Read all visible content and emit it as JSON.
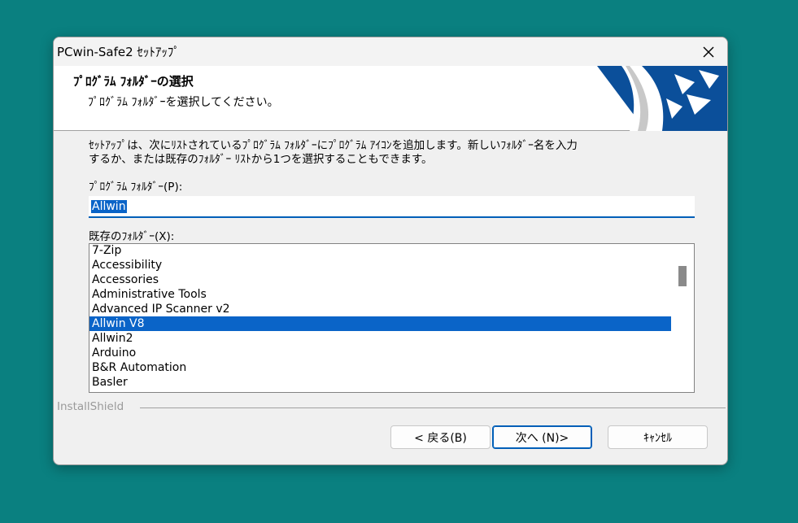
{
  "window": {
    "title": "PCwin-Safe2 ｾｯﾄｱｯﾌﾟ",
    "close_label": "✕"
  },
  "header": {
    "title": "ﾌﾟﾛｸﾞﾗﾑ ﾌｫﾙﾀﾞｰの選択",
    "subtitle": "ﾌﾟﾛｸﾞﾗﾑ ﾌｫﾙﾀﾞｰを選択してください。"
  },
  "description": {
    "line1": "ｾｯﾄｱｯﾌﾟは、次にﾘｽﾄされているﾌﾟﾛｸﾞﾗﾑ ﾌｫﾙﾀﾞｰにﾌﾟﾛｸﾞﾗﾑ ｱｲｺﾝを追加します。新しいﾌｫﾙﾀﾞｰ名を入力",
    "line2": "するか、または既存のﾌｫﾙﾀﾞｰ ﾘｽﾄから1つを選択することもできます。"
  },
  "program_folder": {
    "label": "ﾌﾟﾛｸﾞﾗﾑ ﾌｫﾙﾀﾞｰ(P):",
    "value": "Allwin"
  },
  "existing_folders": {
    "label": "既存のﾌｫﾙﾀﾞｰ(X):",
    "items": [
      "7-Zip",
      "Accessibility",
      "Accessories",
      "Administrative Tools",
      "Advanced IP Scanner v2",
      "Allwin V8",
      "Allwin2",
      "Arduino",
      "B&R Automation",
      "Basler"
    ],
    "selected_index": 5
  },
  "footer": {
    "brand": "InstallShield",
    "back_label": "< 戻る(B)",
    "next_label": "次へ (N)>",
    "cancel_label": "ｷｬﾝｾﾙ"
  },
  "colors": {
    "desktop": "#0a8080",
    "selection": "#0a64c8",
    "accent": "#005fb8",
    "logo_blue": "#0b4f9a"
  }
}
